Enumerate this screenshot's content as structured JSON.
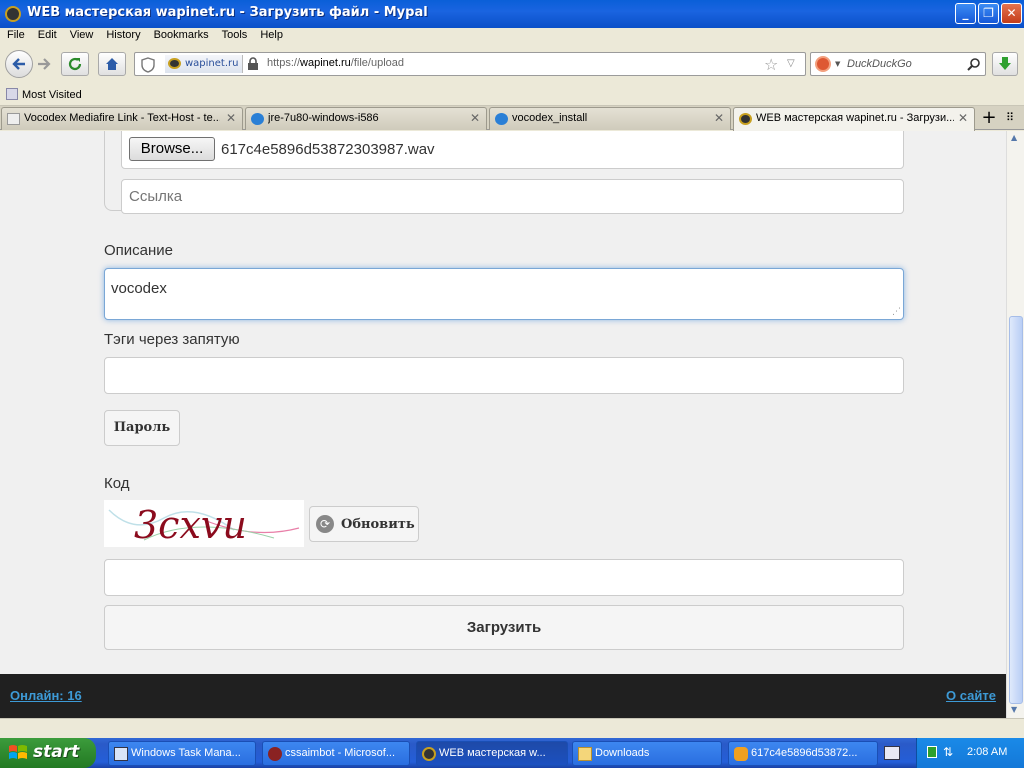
{
  "window": {
    "title": "WEB мастерская wapinet.ru - Загрузить файл - Mypal",
    "minimize": "_",
    "maximize": "❐",
    "close": "✕"
  },
  "menu": [
    "File",
    "Edit",
    "View",
    "History",
    "Bookmarks",
    "Tools",
    "Help"
  ],
  "nav": {
    "site_identity": "wapinet.ru",
    "url_prefix": "https://",
    "url_host": "wapinet.ru",
    "url_path": "/file/upload",
    "search_placeholder": "DuckDuckGo"
  },
  "bookmarks": {
    "most_visited": "Most Visited"
  },
  "tabs": [
    {
      "label": "Vocodex Mediafire Link - Text-Host - te..."
    },
    {
      "label": "jre-7u80-windows-i586"
    },
    {
      "label": "vocodex_install"
    },
    {
      "label": "WEB мастерская wapinet.ru - Загрузи..."
    }
  ],
  "form": {
    "browse_button": "Browse...",
    "file_name": "617c4e5896d53872303987.wav",
    "link_placeholder": "Ссылка",
    "description_label": "Описание",
    "description_value": "vocodex",
    "tags_label": "Тэги через запятую",
    "tags_value": "",
    "password_button": "Пароль",
    "code_label": "Код",
    "captcha_text": "3cxvu",
    "refresh_button": "Обновить",
    "code_value": "",
    "submit_button": "Загрузить"
  },
  "footer": {
    "online": "Онлайн: 16",
    "about": "О сайте"
  },
  "taskbar": {
    "start": "start",
    "tasks": [
      {
        "label": "Windows Task Mana..."
      },
      {
        "label": "cssaimbot - Microsof..."
      },
      {
        "label": "WEB мастерская w..."
      },
      {
        "label": "Downloads"
      },
      {
        "label": "617c4e5896d53872..."
      }
    ],
    "clock": "2:08 AM"
  },
  "colors": {
    "link": "#3d9ad6",
    "footer_bg": "#202020",
    "taskbar": "#245ed8",
    "start_green": "#2f8a2f"
  }
}
